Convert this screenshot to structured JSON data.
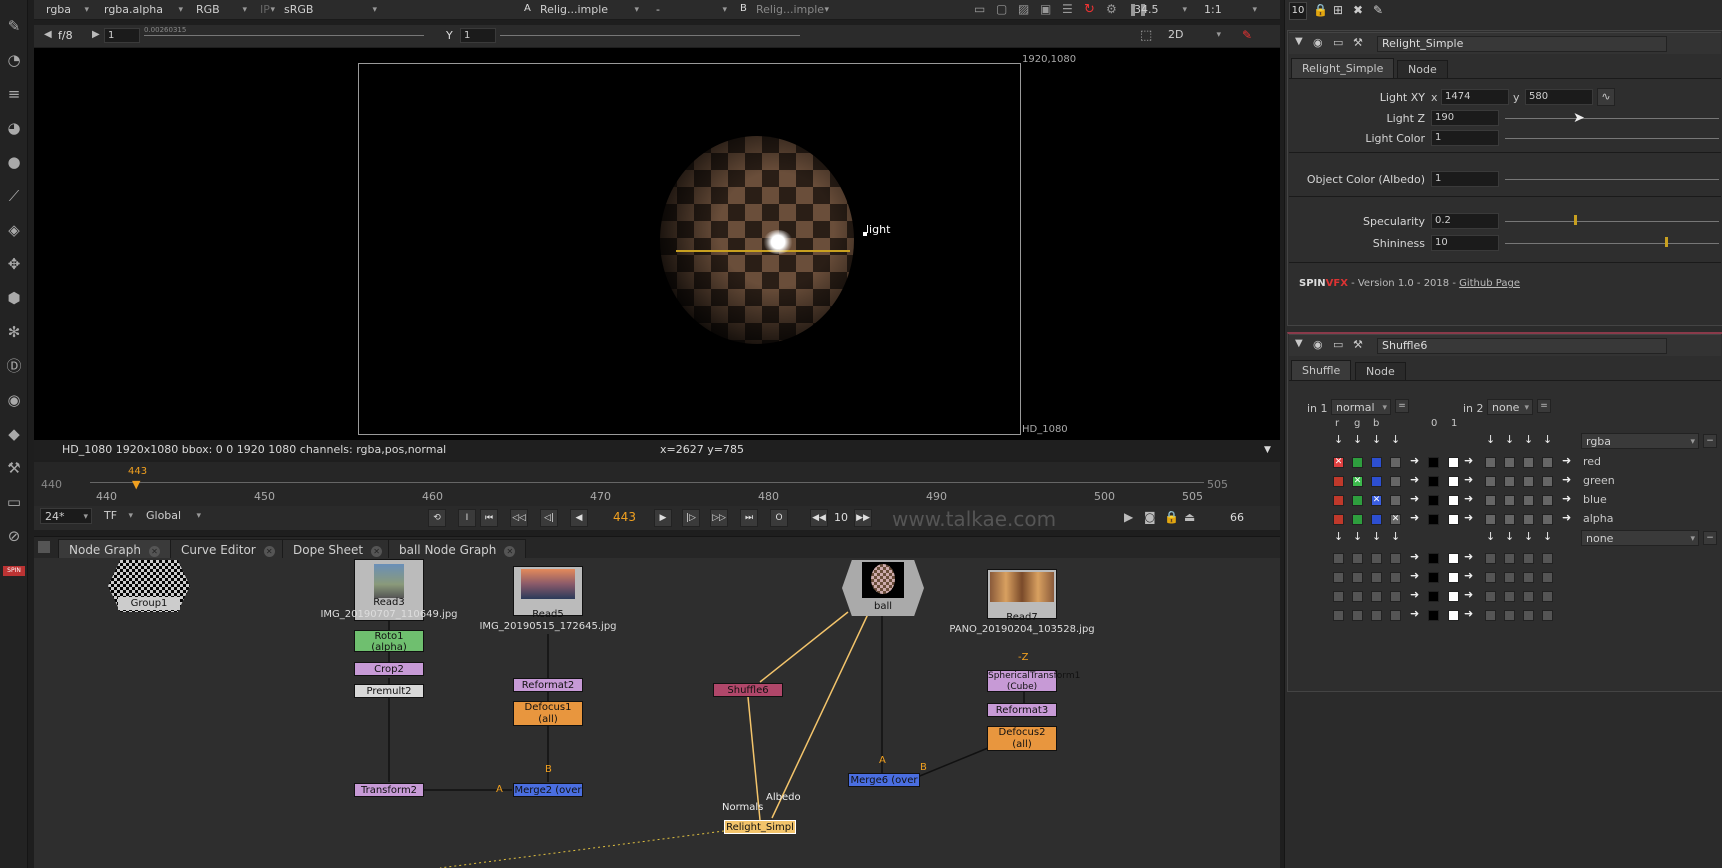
{
  "viewer_toolbar": {
    "channels": "rgba",
    "alpha": "rgba.alpha",
    "display": "RGB",
    "ip": "IP",
    "lut": "sRGB",
    "input_a_label": "A",
    "input_a": "Relig...imple",
    "compare": "-",
    "input_b_label": "B",
    "input_b": "Relig...imple",
    "zoom": "34.5",
    "ratio": "1:1"
  },
  "viewer_toolbar2": {
    "fstop": "f/8",
    "gain": "1",
    "gain_ticks": "0.00260315",
    "y_label": "Y",
    "gamma": "1",
    "view_mode": "2D"
  },
  "viewer": {
    "resolution_tr": "1920,1080",
    "format_br": "HD_1080",
    "light_label": "light",
    "info": "HD_1080 1920x1080  bbox: 0 0 1920 1080 channels: rgba,pos,normal",
    "coords": "x=2627 y=785"
  },
  "timeline": {
    "start": "440",
    "end": "505",
    "current": "443",
    "ticks": [
      "440",
      "450",
      "460",
      "470",
      "480",
      "490",
      "500",
      "505"
    ],
    "fps": "24*",
    "tf": "TF",
    "range": "Global",
    "frame_field": "443",
    "step": "10",
    "end_field": "66",
    "watermark": "www.talkae.com"
  },
  "tabs": [
    {
      "label": "Node Graph"
    },
    {
      "label": "Curve Editor"
    },
    {
      "label": "Dope Sheet"
    },
    {
      "label": "ball Node Graph"
    }
  ],
  "nodes": {
    "group1": "Group1",
    "read3": "Read3",
    "read3_file": "IMG_20190707_110649.jpg",
    "roto1": "Roto1",
    "roto1_sub": "(alpha)",
    "crop2": "Crop2",
    "premult2": "Premult2",
    "transform2": "Transform2",
    "read5": "Read5",
    "read5_file": "IMG_20190515_172645.jpg",
    "reformat2": "Reformat2",
    "defocus1": "Defocus1",
    "defocus1_sub": "(all)",
    "merge2": "Merge2 (over",
    "ball": "ball",
    "shuffle6": "Shuffle6",
    "merge6": "Merge6 (over",
    "relight": "Relight_Simpl",
    "normals": "Normals",
    "albedo": "Albedo",
    "read7": "Read7",
    "read7_file": "PANO_20190204_103528.jpg",
    "z": "-Z",
    "spherical": "SphericalTransform1",
    "spherical_sub": "(Cube)",
    "reformat3": "Reformat3",
    "defocus2": "Defocus2",
    "defocus2_sub": "(all)",
    "pin_a": "A",
    "pin_b": "B",
    "pin_a2": "A",
    "pin_b2": "B"
  },
  "props_top": {
    "count": "10"
  },
  "relight_panel": {
    "name": "Relight_Simple",
    "tab1": "Relight_Simple",
    "tab2": "Node",
    "light_xy_label": "Light XY",
    "x_label": "x",
    "x_value": "1474",
    "y_label": "y",
    "y_value": "580",
    "light_z_label": "Light Z",
    "light_z_value": "190",
    "light_color_label": "Light Color",
    "light_color_value": "1",
    "albedo_label": "Object Color (Albedo)",
    "albedo_value": "1",
    "specularity_label": "Specularity",
    "specularity_value": "0.2",
    "shininess_label": "Shininess",
    "shininess_value": "10",
    "credit_brand_a": "SPIN",
    "credit_brand_b": "VFX",
    "credit_text": " - Version 1.0 - 2018 - ",
    "credit_link": "Github Page"
  },
  "shuffle_panel": {
    "name": "Shuffle6",
    "tab1": "Shuffle",
    "tab2": "Node",
    "in1_label": "in 1",
    "in1_value": "normal",
    "in2_label": "in 2",
    "in2_value": "none",
    "col_r": "r",
    "col_g": "g",
    "col_b": "b",
    "col_0": "0",
    "col_1": "1",
    "out1_value": "rgba",
    "out2_value": "none",
    "channels": [
      "red",
      "green",
      "blue",
      "alpha"
    ]
  },
  "colors": {
    "accent": "#f0a020",
    "roto": "#6fbf6f",
    "reformat": "#c79ad6",
    "defocus": "#e8963e",
    "merge": "#4a6ee0",
    "shuffle": "#b0476a",
    "relight": "#f3c46b"
  }
}
